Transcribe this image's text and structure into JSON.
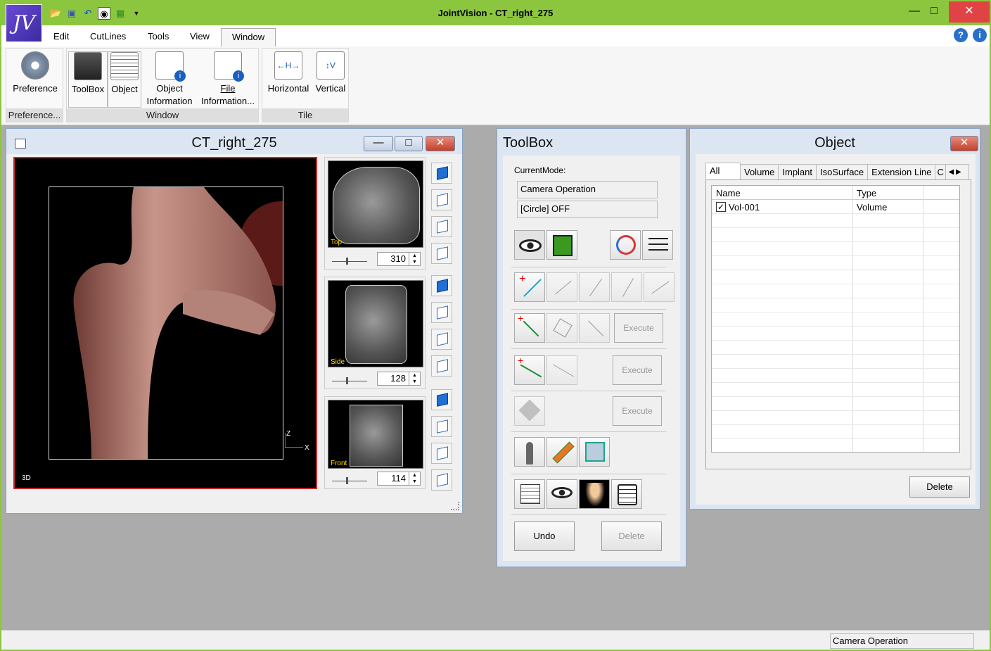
{
  "app": {
    "title": "JointVision - CT_right_275",
    "logo": "JV"
  },
  "menu": {
    "items": [
      "Edit",
      "CutLines",
      "Tools",
      "View"
    ],
    "active": "Window"
  },
  "ribbon": {
    "preference": {
      "button": "Preference",
      "group": "Preference..."
    },
    "window": {
      "toolbox": "ToolBox",
      "object": "Object",
      "object_info_1": "Object",
      "object_info_2": "Information",
      "file_info_1": "File",
      "file_info_2": "Information...",
      "group": "Window"
    },
    "tile": {
      "horizontal": "Horizontal",
      "vertical": "Vertical",
      "group": "Tile"
    }
  },
  "viewer": {
    "title": "CT_right_275",
    "view_label": "3D",
    "axis_z": "Z",
    "axis_x": "X",
    "slices": [
      {
        "label": "Top",
        "value": "310"
      },
      {
        "label": "Side",
        "value": "128"
      },
      {
        "label": "Front",
        "value": "114"
      }
    ]
  },
  "toolbox": {
    "title": "ToolBox",
    "mode_label": "CurrentMode:",
    "mode_value": "Camera Operation",
    "circle_value": "[Circle] OFF",
    "execute_1": "Execute",
    "execute_2": "Execute",
    "execute_3": "Execute",
    "undo": "Undo",
    "delete": "Delete"
  },
  "object": {
    "title": "Object",
    "tabs": [
      "All",
      "Volume",
      "Implant",
      "IsoSurface",
      "Extension Line",
      "C"
    ],
    "columns": [
      "Name",
      "Type"
    ],
    "rows": [
      {
        "name": "Vol-001",
        "type": "Volume",
        "checked": true
      }
    ],
    "delete": "Delete"
  },
  "status": {
    "text": "Camera Operation"
  },
  "colors": {
    "titlebar": "#8cc63f",
    "close": "#e04343",
    "mdi_border": "#c0282a",
    "accent_blue": "#1f6fd6"
  }
}
